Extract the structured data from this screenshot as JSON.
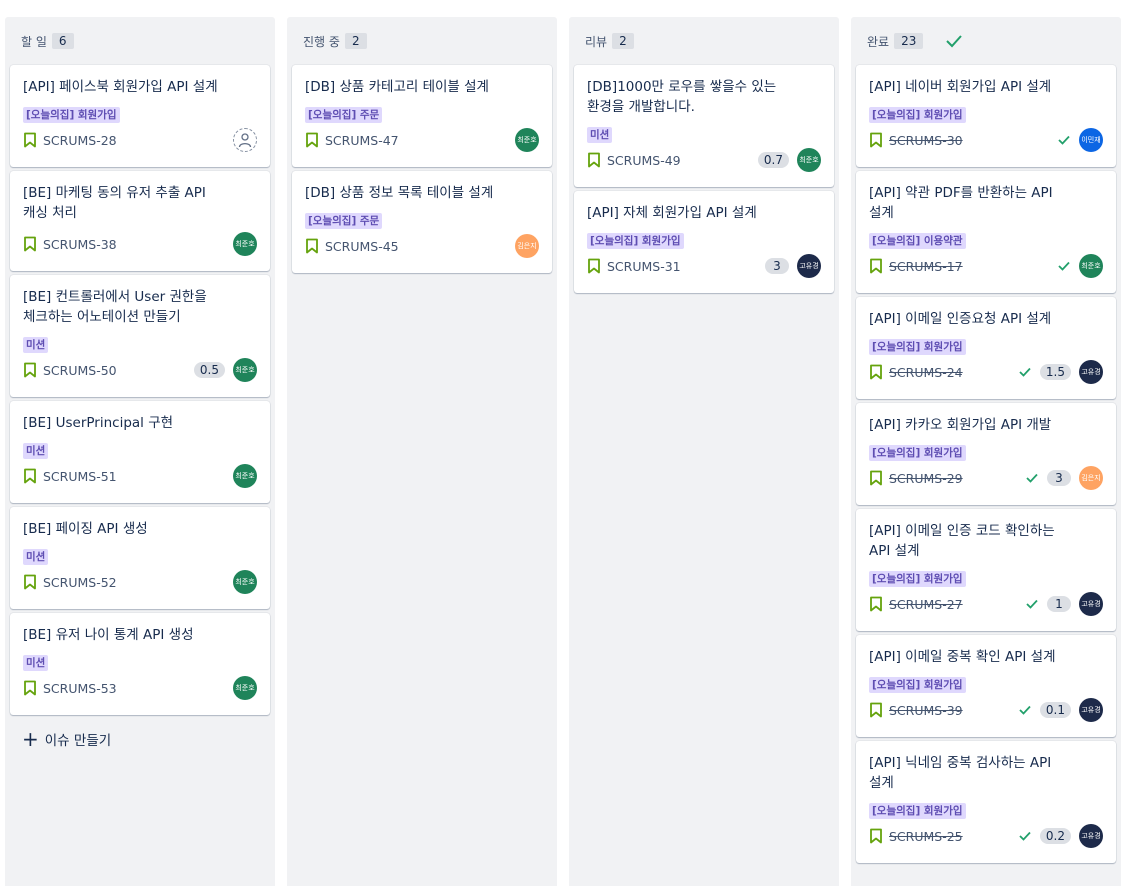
{
  "colors": {
    "done_check": "#22a06b",
    "label_bg": "#dfd8fd",
    "label_text": "#5e4db2",
    "bookmark": "#65a30d"
  },
  "columns": [
    {
      "title": "할 일",
      "count": "6",
      "cards": [
        {
          "title": "[API] 페이스북 회원가입 API 설계",
          "label": "[오늘의집] 회원가입",
          "key": "SCRUMS-28",
          "avatar": {
            "text": "",
            "color": "#ffffff",
            "empty": true
          }
        },
        {
          "title": "[BE] 마케팅 동의 유저 추출 API 캐싱 처리",
          "label": "",
          "key": "SCRUMS-38",
          "avatar": {
            "text": "최준호",
            "color": "#1f845a"
          }
        },
        {
          "title": "[BE] 컨트롤러에서 User 권한을 체크하는 어노테이션 만들기",
          "label": "미션",
          "key": "SCRUMS-50",
          "points": "0.5",
          "avatar": {
            "text": "최준호",
            "color": "#1f845a"
          }
        },
        {
          "title": "[BE] UserPrincipal 구현",
          "label": "미션",
          "key": "SCRUMS-51",
          "avatar": {
            "text": "최준호",
            "color": "#1f845a"
          }
        },
        {
          "title": "[BE] 페이징 API 생성",
          "label": "미션",
          "key": "SCRUMS-52",
          "avatar": {
            "text": "최준호",
            "color": "#1f845a"
          }
        },
        {
          "title": "[BE] 유저 나이 통계 API 생성",
          "label": "미션",
          "key": "SCRUMS-53",
          "avatar": {
            "text": "최준호",
            "color": "#1f845a"
          }
        }
      ],
      "create_label": "이슈 만들기"
    },
    {
      "title": "진행 중",
      "count": "2",
      "cards": [
        {
          "title": "[DB] 상품 카테고리 테이블 설계",
          "label": "[오늘의집] 주문",
          "key": "SCRUMS-47",
          "avatar": {
            "text": "최준호",
            "color": "#1f845a"
          }
        },
        {
          "title": "[DB] 상품 정보 목록 테이블 설계",
          "label": "[오늘의집] 주문",
          "key": "SCRUMS-45",
          "avatar": {
            "text": "김은지",
            "color": "#fea362"
          }
        }
      ]
    },
    {
      "title": "리뷰",
      "count": "2",
      "cards": [
        {
          "title": "[DB]1000만 로우를 쌓을수 있는 환경을 개발합니다.",
          "label": "미션",
          "key": "SCRUMS-49",
          "points": "0.7",
          "avatar": {
            "text": "최준호",
            "color": "#1f845a"
          }
        },
        {
          "title": "[API] 자체 회원가입 API 설계",
          "label": "[오늘의집] 회원가입",
          "key": "SCRUMS-31",
          "points": "3",
          "avatar": {
            "text": "고유경",
            "color": "#1d2a4a"
          }
        }
      ]
    },
    {
      "title": "완료",
      "count": "23",
      "cards": [
        {
          "title": "[API] 네이버 회원가입 API 설계",
          "label": "[오늘의집] 회원가입",
          "key": "SCRUMS-30",
          "done": true,
          "avatar": {
            "text": "이민재",
            "color": "#0c66e4"
          }
        },
        {
          "title": "[API] 약관 PDF를 반환하는 API 설계",
          "label": "[오늘의집] 이용약관",
          "key": "SCRUMS-17",
          "done": true,
          "avatar": {
            "text": "최준호",
            "color": "#1f845a"
          }
        },
        {
          "title": "[API] 이메일 인증요청 API 설계",
          "label": "[오늘의집] 회원가입",
          "key": "SCRUMS-24",
          "done": true,
          "points": "1.5",
          "avatar": {
            "text": "고유경",
            "color": "#1d2a4a"
          }
        },
        {
          "title": "[API] 카카오 회원가입 API 개발",
          "label": "[오늘의집] 회원가입",
          "key": "SCRUMS-29",
          "done": true,
          "points": "3",
          "avatar": {
            "text": "김은지",
            "color": "#fea362"
          }
        },
        {
          "title": "[API] 이메일 인증 코드 확인하는 API 설계",
          "label": "[오늘의집] 회원가입",
          "key": "SCRUMS-27",
          "done": true,
          "points": "1",
          "avatar": {
            "text": "고유경",
            "color": "#1d2a4a"
          }
        },
        {
          "title": "[API] 이메일 중복 확인 API 설계",
          "label": "[오늘의집] 회원가입",
          "key": "SCRUMS-39",
          "done": true,
          "points": "0.1",
          "avatar": {
            "text": "고유경",
            "color": "#1d2a4a"
          }
        },
        {
          "title": "[API] 닉네임 중복 검사하는 API 설계",
          "label": "[오늘의집] 회원가입",
          "key": "SCRUMS-25",
          "done": true,
          "points": "0.2",
          "avatar": {
            "text": "고유경",
            "color": "#1d2a4a"
          }
        }
      ]
    }
  ]
}
